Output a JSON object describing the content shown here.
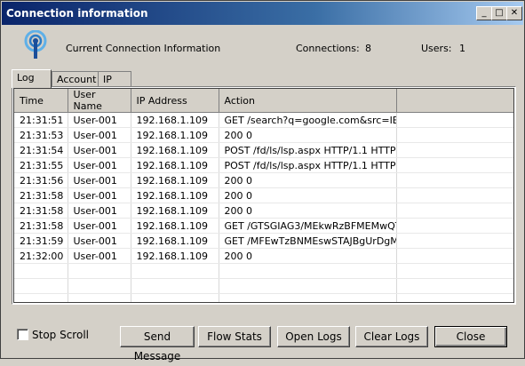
{
  "window": {
    "title": "Connection information",
    "controls": {
      "minimize": "_",
      "maximize": "□",
      "close": "✕"
    }
  },
  "header": {
    "icon": "wifi-signal-icon",
    "label": "Current Connection Information",
    "connections_label": "Connections:",
    "connections_value": "8",
    "users_label": "Users:",
    "users_value": "1"
  },
  "tabs": [
    "Log",
    "Account",
    "IP"
  ],
  "table": {
    "columns": [
      "Time",
      "User Name",
      "IP Address",
      "Action"
    ],
    "rows": [
      [
        "21:31:51",
        "User-001",
        "192.168.1.109",
        "GET /search?q=google.com&src=IE-..."
      ],
      [
        "21:31:53",
        "User-001",
        "192.168.1.109",
        " 200 0"
      ],
      [
        "21:31:54",
        "User-001",
        "192.168.1.109",
        "POST /fd/ls/lsp.aspx HTTP/1.1 HTTP"
      ],
      [
        "21:31:55",
        "User-001",
        "192.168.1.109",
        "POST /fd/ls/lsp.aspx HTTP/1.1 HTTP"
      ],
      [
        "21:31:56",
        "User-001",
        "192.168.1.109",
        " 200 0"
      ],
      [
        "21:31:58",
        "User-001",
        "192.168.1.109",
        " 200 0"
      ],
      [
        "21:31:58",
        "User-001",
        "192.168.1.109",
        " 200 0"
      ],
      [
        "21:31:58",
        "User-001",
        "192.168.1.109",
        "GET /GTSGIAG3/MEkwRzBFMEMwQT..."
      ],
      [
        "21:31:59",
        "User-001",
        "192.168.1.109",
        "GET /MFEwTzBNMEswSTAJBgUrDgM..."
      ],
      [
        "21:32:00",
        "User-001",
        "192.168.1.109",
        " 200 0"
      ]
    ]
  },
  "footer": {
    "stop_scroll": "Stop Scroll",
    "send_message": "Send Message",
    "flow_stats": "Flow Stats",
    "open_logs": "Open Logs",
    "clear_logs": "Clear Logs",
    "close": "Close"
  }
}
